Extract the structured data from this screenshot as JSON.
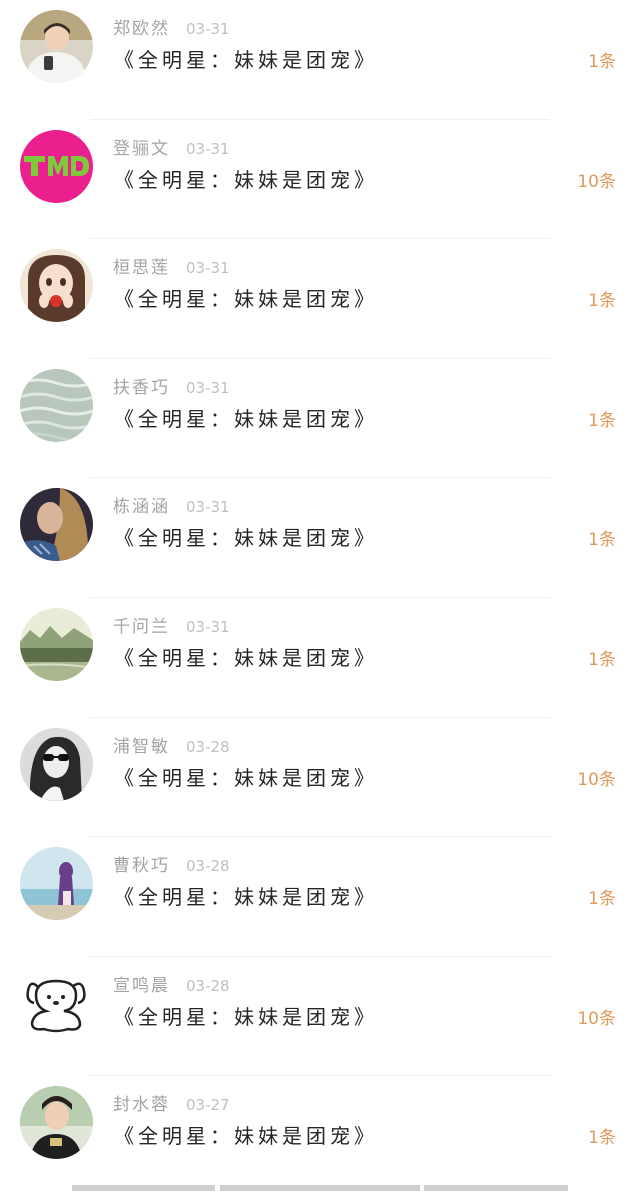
{
  "items": [
    {
      "name": "郑欧然",
      "date": "03-31",
      "title": "《全明星：妹妹是团宠》",
      "count": "1条",
      "avatar_icon": "boy-with-phone-avatar"
    },
    {
      "name": "登骊文",
      "date": "03-31",
      "title": "《全明星：妹妹是团宠》",
      "count": "10条",
      "avatar_icon": "tmd-logo-avatar"
    },
    {
      "name": "桓思莲",
      "date": "03-31",
      "title": "《全明星：妹妹是团宠》",
      "count": "1条",
      "avatar_icon": "anime-girl-avatar"
    },
    {
      "name": "扶香巧",
      "date": "03-31",
      "title": "《全明星：妹妹是团宠》",
      "count": "1条",
      "avatar_icon": "water-ripple-avatar"
    },
    {
      "name": "栋涵涵",
      "date": "03-31",
      "title": "《全明星：妹妹是团宠》",
      "count": "1条",
      "avatar_icon": "woman-hair-avatar"
    },
    {
      "name": "千问兰",
      "date": "03-31",
      "title": "《全明星：妹妹是团宠》",
      "count": "1条",
      "avatar_icon": "river-landscape-avatar"
    },
    {
      "name": "浦智敏",
      "date": "03-28",
      "title": "《全明星：妹妹是团宠》",
      "count": "10条",
      "avatar_icon": "sunglasses-woman-avatar"
    },
    {
      "name": "曹秋巧",
      "date": "03-28",
      "title": "《全明星：妹妹是团宠》",
      "count": "1条",
      "avatar_icon": "seaside-girl-avatar"
    },
    {
      "name": "宣鸣晨",
      "date": "03-28",
      "title": "《全明星：妹妹是团宠》",
      "count": "10条",
      "avatar_icon": "cartoon-dog-avatar"
    },
    {
      "name": "封水蓉",
      "date": "03-27",
      "title": "《全明星：妹妹是团宠》",
      "count": "1条",
      "avatar_icon": "boy-portrait-avatar"
    }
  ],
  "colors": {
    "name": "#a3a3a3",
    "date": "#c0c0c0",
    "title": "#262626",
    "count": "#e09a5a",
    "divider": "#f0f0f0"
  }
}
